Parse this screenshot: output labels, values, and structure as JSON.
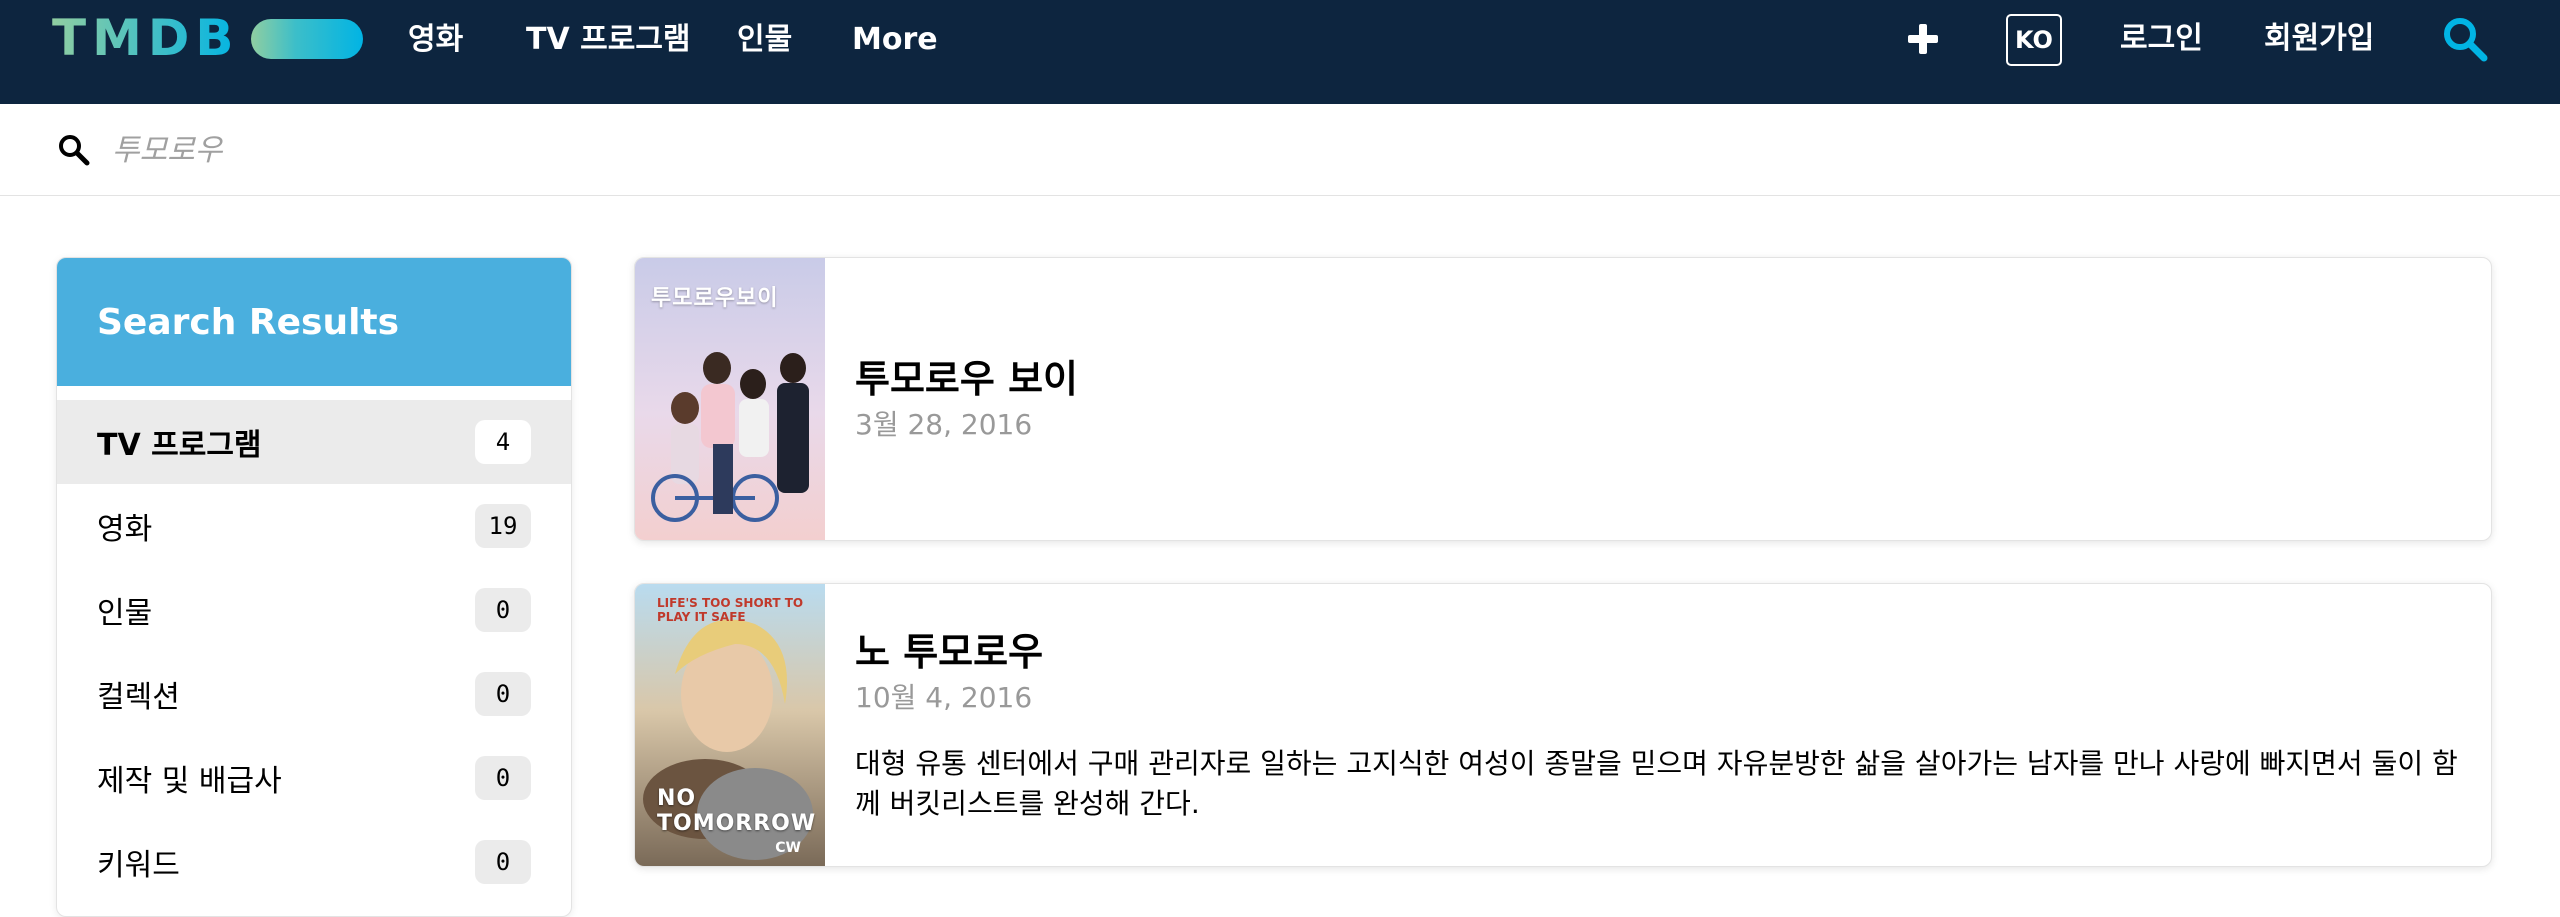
{
  "nav": {
    "logo_text": "TMDB",
    "items": [
      "영화",
      "TV 프로그램",
      "인물",
      "More"
    ],
    "lang": "KO",
    "login": "로그인",
    "signup": "회원가입",
    "add_icon": "plus-icon",
    "search_icon": "search-icon"
  },
  "search": {
    "placeholder": "투모로우",
    "icon": "search-icon"
  },
  "sidebar": {
    "header": "Search Results",
    "items": [
      {
        "label": "TV 프로그램",
        "count": "4",
        "active": true
      },
      {
        "label": "영화",
        "count": "19"
      },
      {
        "label": "인물",
        "count": "0"
      },
      {
        "label": "컬렉션",
        "count": "0"
      },
      {
        "label": "제작 및 배급사",
        "count": "0"
      },
      {
        "label": "키워드",
        "count": "0"
      }
    ]
  },
  "results": [
    {
      "title": "투모로우 보이",
      "date": "3월 28, 2016",
      "overview": "",
      "poster_text": "투모로우보이"
    },
    {
      "title": "노 투모로우",
      "date": "10월 4, 2016",
      "overview": "대형 유통 센터에서 구매 관리자로 일하는 고지식한 여성이 종말을 믿으며 자유분방한 삶을 살아가는 남자를 만나 사랑에 빠지면서 둘이 함께 버킷리스트를 완성해 간다.",
      "poster_tagline": "LIFE'S TOO SHORT TO PLAY IT SAFE",
      "poster_text": "NO TOMORROW",
      "poster_network": "CW"
    }
  ],
  "colors": {
    "nav_bg": "#0d253f",
    "sidebar_header_bg": "#4aafde",
    "badge_bg": "#ebebeb",
    "accent": "#01b4e4"
  }
}
